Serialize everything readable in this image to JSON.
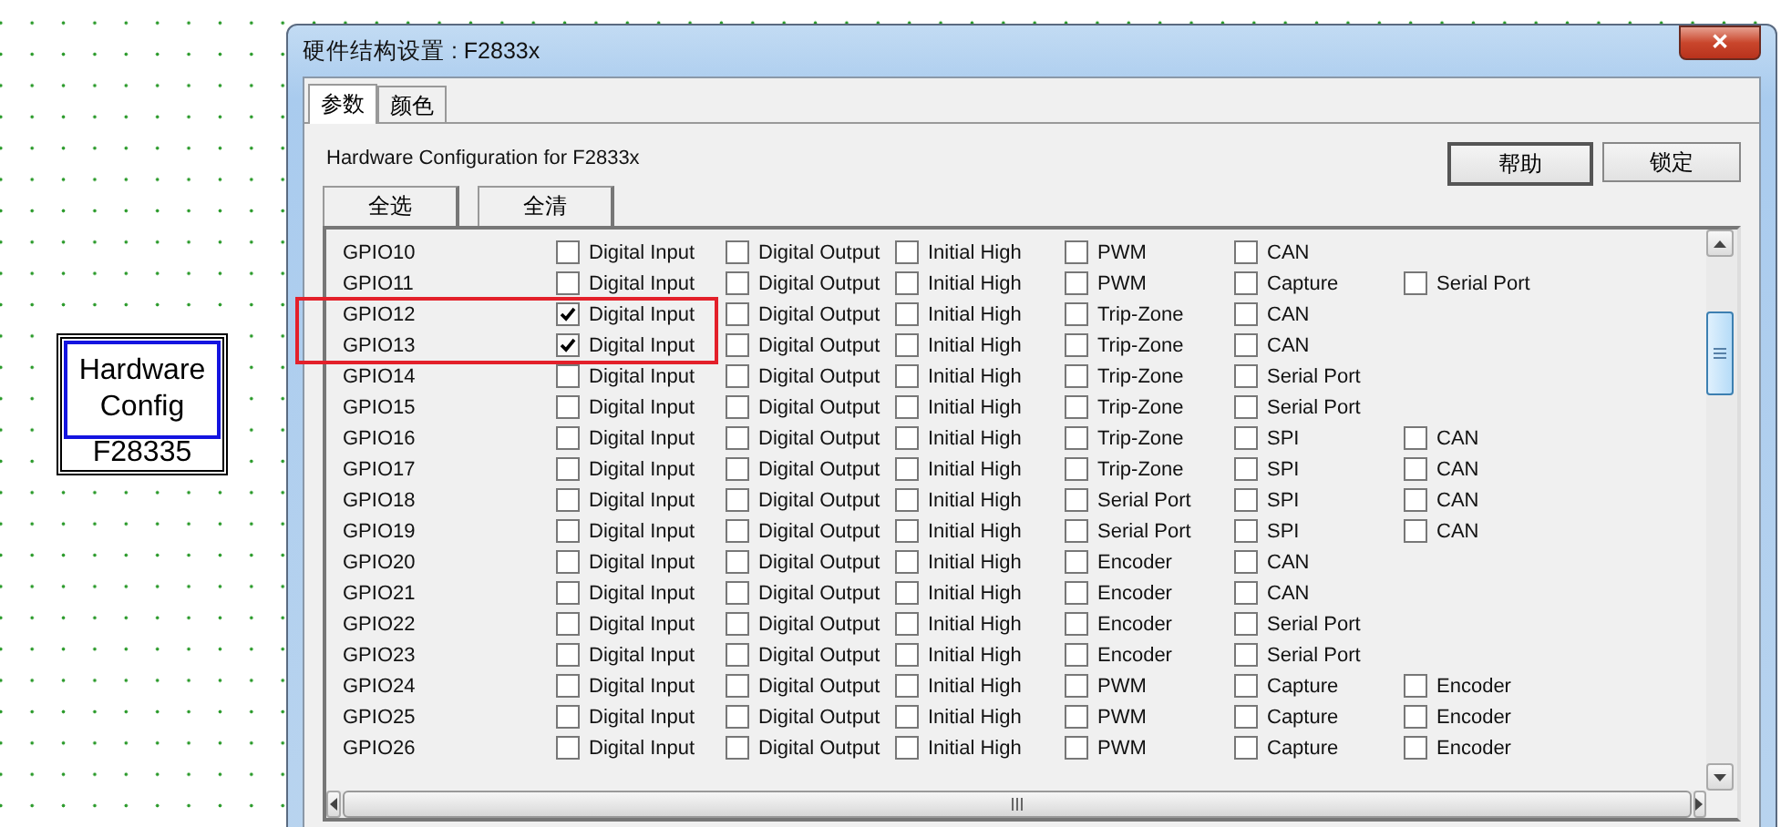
{
  "block": {
    "title": "Hardware Config",
    "label": "F28335"
  },
  "window": {
    "title": "硬件结构设置 : F2833x",
    "close": "✕"
  },
  "tabs": [
    {
      "label": "参数",
      "selected": true
    },
    {
      "label": "颜色",
      "selected": false
    }
  ],
  "heading": "Hardware Configuration for F2833x",
  "buttons": [
    "帮助",
    "锁定"
  ],
  "select_buttons": [
    "全选",
    "全清"
  ],
  "rows": [
    {
      "name": "GPIO10",
      "options": [
        {
          "label": "Digital Input",
          "checked": false
        },
        {
          "label": "Digital Output",
          "checked": false
        },
        {
          "label": "Initial High",
          "checked": false
        },
        {
          "label": "PWM",
          "checked": false
        },
        {
          "label": "CAN",
          "checked": false
        }
      ]
    },
    {
      "name": "GPIO11",
      "options": [
        {
          "label": "Digital Input",
          "checked": false
        },
        {
          "label": "Digital Output",
          "checked": false
        },
        {
          "label": "Initial High",
          "checked": false
        },
        {
          "label": "PWM",
          "checked": false
        },
        {
          "label": "Capture",
          "checked": false
        },
        {
          "label": "Serial Port",
          "checked": false
        }
      ]
    },
    {
      "name": "GPIO12",
      "options": [
        {
          "label": "Digital Input",
          "checked": true
        },
        {
          "label": "Digital Output",
          "checked": false
        },
        {
          "label": "Initial High",
          "checked": false
        },
        {
          "label": "Trip-Zone",
          "checked": false
        },
        {
          "label": "CAN",
          "checked": false
        }
      ]
    },
    {
      "name": "GPIO13",
      "options": [
        {
          "label": "Digital Input",
          "checked": true
        },
        {
          "label": "Digital Output",
          "checked": false
        },
        {
          "label": "Initial High",
          "checked": false
        },
        {
          "label": "Trip-Zone",
          "checked": false
        },
        {
          "label": "CAN",
          "checked": false
        }
      ]
    },
    {
      "name": "GPIO14",
      "options": [
        {
          "label": "Digital Input",
          "checked": false
        },
        {
          "label": "Digital Output",
          "checked": false
        },
        {
          "label": "Initial High",
          "checked": false
        },
        {
          "label": "Trip-Zone",
          "checked": false
        },
        {
          "label": "Serial Port",
          "checked": false
        }
      ]
    },
    {
      "name": "GPIO15",
      "options": [
        {
          "label": "Digital Input",
          "checked": false
        },
        {
          "label": "Digital Output",
          "checked": false
        },
        {
          "label": "Initial High",
          "checked": false
        },
        {
          "label": "Trip-Zone",
          "checked": false
        },
        {
          "label": "Serial Port",
          "checked": false
        }
      ]
    },
    {
      "name": "GPIO16",
      "options": [
        {
          "label": "Digital Input",
          "checked": false
        },
        {
          "label": "Digital Output",
          "checked": false
        },
        {
          "label": "Initial High",
          "checked": false
        },
        {
          "label": "Trip-Zone",
          "checked": false
        },
        {
          "label": "SPI",
          "checked": false
        },
        {
          "label": "CAN",
          "checked": false
        }
      ]
    },
    {
      "name": "GPIO17",
      "options": [
        {
          "label": "Digital Input",
          "checked": false
        },
        {
          "label": "Digital Output",
          "checked": false
        },
        {
          "label": "Initial High",
          "checked": false
        },
        {
          "label": "Trip-Zone",
          "checked": false
        },
        {
          "label": "SPI",
          "checked": false
        },
        {
          "label": "CAN",
          "checked": false
        }
      ]
    },
    {
      "name": "GPIO18",
      "options": [
        {
          "label": "Digital Input",
          "checked": false
        },
        {
          "label": "Digital Output",
          "checked": false
        },
        {
          "label": "Initial High",
          "checked": false
        },
        {
          "label": "Serial Port",
          "checked": false
        },
        {
          "label": "SPI",
          "checked": false
        },
        {
          "label": "CAN",
          "checked": false
        }
      ]
    },
    {
      "name": "GPIO19",
      "options": [
        {
          "label": "Digital Input",
          "checked": false
        },
        {
          "label": "Digital Output",
          "checked": false
        },
        {
          "label": "Initial High",
          "checked": false
        },
        {
          "label": "Serial Port",
          "checked": false
        },
        {
          "label": "SPI",
          "checked": false
        },
        {
          "label": "CAN",
          "checked": false
        }
      ]
    },
    {
      "name": "GPIO20",
      "options": [
        {
          "label": "Digital Input",
          "checked": false
        },
        {
          "label": "Digital Output",
          "checked": false
        },
        {
          "label": "Initial High",
          "checked": false
        },
        {
          "label": "Encoder",
          "checked": false
        },
        {
          "label": "CAN",
          "checked": false
        }
      ]
    },
    {
      "name": "GPIO21",
      "options": [
        {
          "label": "Digital Input",
          "checked": false
        },
        {
          "label": "Digital Output",
          "checked": false
        },
        {
          "label": "Initial High",
          "checked": false
        },
        {
          "label": "Encoder",
          "checked": false
        },
        {
          "label": "CAN",
          "checked": false
        }
      ]
    },
    {
      "name": "GPIO22",
      "options": [
        {
          "label": "Digital Input",
          "checked": false
        },
        {
          "label": "Digital Output",
          "checked": false
        },
        {
          "label": "Initial High",
          "checked": false
        },
        {
          "label": "Encoder",
          "checked": false
        },
        {
          "label": "Serial Port",
          "checked": false
        }
      ]
    },
    {
      "name": "GPIO23",
      "options": [
        {
          "label": "Digital Input",
          "checked": false
        },
        {
          "label": "Digital Output",
          "checked": false
        },
        {
          "label": "Initial High",
          "checked": false
        },
        {
          "label": "Encoder",
          "checked": false
        },
        {
          "label": "Serial Port",
          "checked": false
        }
      ]
    },
    {
      "name": "GPIO24",
      "options": [
        {
          "label": "Digital Input",
          "checked": false
        },
        {
          "label": "Digital Output",
          "checked": false
        },
        {
          "label": "Initial High",
          "checked": false
        },
        {
          "label": "PWM",
          "checked": false
        },
        {
          "label": "Capture",
          "checked": false
        },
        {
          "label": "Encoder",
          "checked": false
        }
      ]
    },
    {
      "name": "GPIO25",
      "options": [
        {
          "label": "Digital Input",
          "checked": false
        },
        {
          "label": "Digital Output",
          "checked": false
        },
        {
          "label": "Initial High",
          "checked": false
        },
        {
          "label": "PWM",
          "checked": false
        },
        {
          "label": "Capture",
          "checked": false
        },
        {
          "label": "Encoder",
          "checked": false
        }
      ]
    },
    {
      "name": "GPIO26",
      "options": [
        {
          "label": "Digital Input",
          "checked": false
        },
        {
          "label": "Digital Output",
          "checked": false
        },
        {
          "label": "Initial High",
          "checked": false
        },
        {
          "label": "PWM",
          "checked": false
        },
        {
          "label": "Capture",
          "checked": false
        },
        {
          "label": "Encoder",
          "checked": false
        }
      ]
    }
  ]
}
